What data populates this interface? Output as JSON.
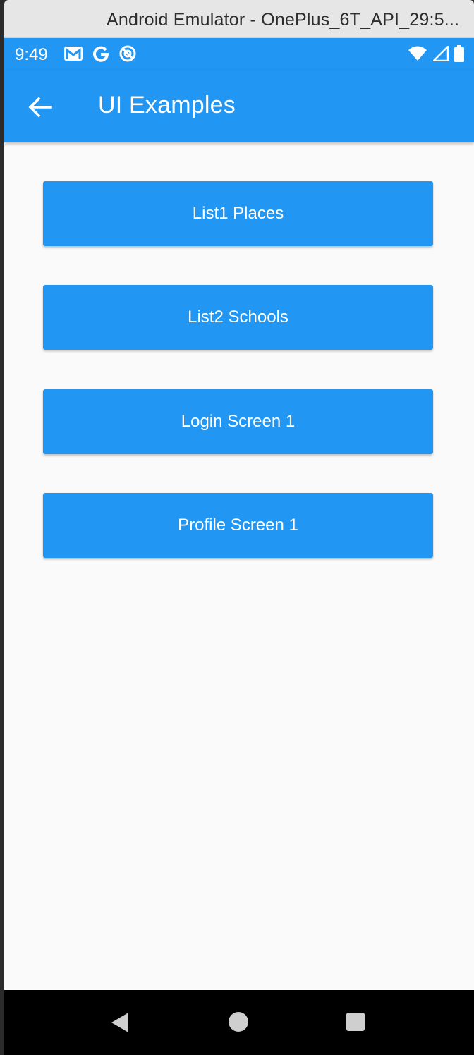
{
  "window": {
    "title": "Android Emulator - OnePlus_6T_API_29:5..."
  },
  "status_bar": {
    "time": "9:49",
    "left_icons": [
      "gmail-icon",
      "google-icon",
      "at-sign-icon"
    ],
    "right_icons": [
      "wifi-icon",
      "cell-signal-icon",
      "battery-icon"
    ]
  },
  "app_bar": {
    "title": "UI Examples",
    "back_icon": "arrow-left-icon"
  },
  "buttons": [
    {
      "label": "List1 Places"
    },
    {
      "label": "List2 Schools"
    },
    {
      "label": "Login Screen 1"
    },
    {
      "label": "Profile Screen 1"
    }
  ],
  "nav_bar": {
    "icons": [
      "nav-back-icon",
      "nav-home-icon",
      "nav-recents-icon"
    ]
  },
  "colors": {
    "primary": "#2196f3",
    "background": "#fafafa",
    "nav_bar": "#000000"
  }
}
